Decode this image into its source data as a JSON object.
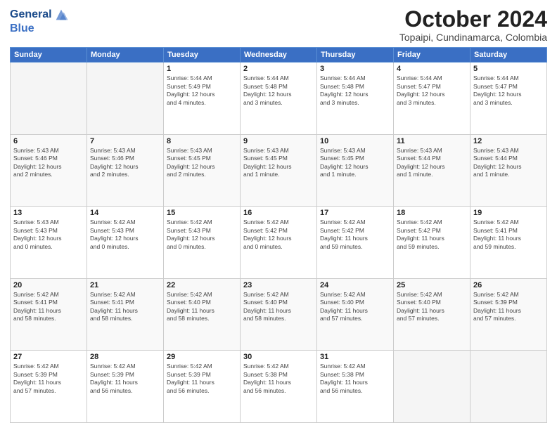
{
  "header": {
    "logo_line1": "General",
    "logo_line2": "Blue",
    "month_title": "October 2024",
    "location": "Topaipi, Cundinamarca, Colombia"
  },
  "days_of_week": [
    "Sunday",
    "Monday",
    "Tuesday",
    "Wednesday",
    "Thursday",
    "Friday",
    "Saturday"
  ],
  "weeks": [
    [
      {
        "day": "",
        "info": ""
      },
      {
        "day": "",
        "info": ""
      },
      {
        "day": "1",
        "info": "Sunrise: 5:44 AM\nSunset: 5:49 PM\nDaylight: 12 hours\nand 4 minutes."
      },
      {
        "day": "2",
        "info": "Sunrise: 5:44 AM\nSunset: 5:48 PM\nDaylight: 12 hours\nand 3 minutes."
      },
      {
        "day": "3",
        "info": "Sunrise: 5:44 AM\nSunset: 5:48 PM\nDaylight: 12 hours\nand 3 minutes."
      },
      {
        "day": "4",
        "info": "Sunrise: 5:44 AM\nSunset: 5:47 PM\nDaylight: 12 hours\nand 3 minutes."
      },
      {
        "day": "5",
        "info": "Sunrise: 5:44 AM\nSunset: 5:47 PM\nDaylight: 12 hours\nand 3 minutes."
      }
    ],
    [
      {
        "day": "6",
        "info": "Sunrise: 5:43 AM\nSunset: 5:46 PM\nDaylight: 12 hours\nand 2 minutes."
      },
      {
        "day": "7",
        "info": "Sunrise: 5:43 AM\nSunset: 5:46 PM\nDaylight: 12 hours\nand 2 minutes."
      },
      {
        "day": "8",
        "info": "Sunrise: 5:43 AM\nSunset: 5:45 PM\nDaylight: 12 hours\nand 2 minutes."
      },
      {
        "day": "9",
        "info": "Sunrise: 5:43 AM\nSunset: 5:45 PM\nDaylight: 12 hours\nand 1 minute."
      },
      {
        "day": "10",
        "info": "Sunrise: 5:43 AM\nSunset: 5:45 PM\nDaylight: 12 hours\nand 1 minute."
      },
      {
        "day": "11",
        "info": "Sunrise: 5:43 AM\nSunset: 5:44 PM\nDaylight: 12 hours\nand 1 minute."
      },
      {
        "day": "12",
        "info": "Sunrise: 5:43 AM\nSunset: 5:44 PM\nDaylight: 12 hours\nand 1 minute."
      }
    ],
    [
      {
        "day": "13",
        "info": "Sunrise: 5:43 AM\nSunset: 5:43 PM\nDaylight: 12 hours\nand 0 minutes."
      },
      {
        "day": "14",
        "info": "Sunrise: 5:42 AM\nSunset: 5:43 PM\nDaylight: 12 hours\nand 0 minutes."
      },
      {
        "day": "15",
        "info": "Sunrise: 5:42 AM\nSunset: 5:43 PM\nDaylight: 12 hours\nand 0 minutes."
      },
      {
        "day": "16",
        "info": "Sunrise: 5:42 AM\nSunset: 5:42 PM\nDaylight: 12 hours\nand 0 minutes."
      },
      {
        "day": "17",
        "info": "Sunrise: 5:42 AM\nSunset: 5:42 PM\nDaylight: 11 hours\nand 59 minutes."
      },
      {
        "day": "18",
        "info": "Sunrise: 5:42 AM\nSunset: 5:42 PM\nDaylight: 11 hours\nand 59 minutes."
      },
      {
        "day": "19",
        "info": "Sunrise: 5:42 AM\nSunset: 5:41 PM\nDaylight: 11 hours\nand 59 minutes."
      }
    ],
    [
      {
        "day": "20",
        "info": "Sunrise: 5:42 AM\nSunset: 5:41 PM\nDaylight: 11 hours\nand 58 minutes."
      },
      {
        "day": "21",
        "info": "Sunrise: 5:42 AM\nSunset: 5:41 PM\nDaylight: 11 hours\nand 58 minutes."
      },
      {
        "day": "22",
        "info": "Sunrise: 5:42 AM\nSunset: 5:40 PM\nDaylight: 11 hours\nand 58 minutes."
      },
      {
        "day": "23",
        "info": "Sunrise: 5:42 AM\nSunset: 5:40 PM\nDaylight: 11 hours\nand 58 minutes."
      },
      {
        "day": "24",
        "info": "Sunrise: 5:42 AM\nSunset: 5:40 PM\nDaylight: 11 hours\nand 57 minutes."
      },
      {
        "day": "25",
        "info": "Sunrise: 5:42 AM\nSunset: 5:40 PM\nDaylight: 11 hours\nand 57 minutes."
      },
      {
        "day": "26",
        "info": "Sunrise: 5:42 AM\nSunset: 5:39 PM\nDaylight: 11 hours\nand 57 minutes."
      }
    ],
    [
      {
        "day": "27",
        "info": "Sunrise: 5:42 AM\nSunset: 5:39 PM\nDaylight: 11 hours\nand 57 minutes."
      },
      {
        "day": "28",
        "info": "Sunrise: 5:42 AM\nSunset: 5:39 PM\nDaylight: 11 hours\nand 56 minutes."
      },
      {
        "day": "29",
        "info": "Sunrise: 5:42 AM\nSunset: 5:39 PM\nDaylight: 11 hours\nand 56 minutes."
      },
      {
        "day": "30",
        "info": "Sunrise: 5:42 AM\nSunset: 5:38 PM\nDaylight: 11 hours\nand 56 minutes."
      },
      {
        "day": "31",
        "info": "Sunrise: 5:42 AM\nSunset: 5:38 PM\nDaylight: 11 hours\nand 56 minutes."
      },
      {
        "day": "",
        "info": ""
      },
      {
        "day": "",
        "info": ""
      }
    ]
  ]
}
